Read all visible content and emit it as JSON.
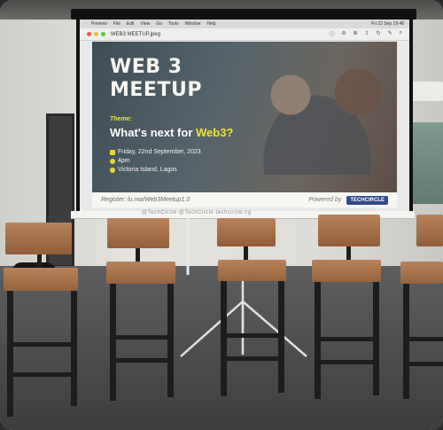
{
  "slide": {
    "menu_items": [
      "Preview",
      "File",
      "Edit",
      "View",
      "Go",
      "Tools",
      "Window",
      "Help"
    ],
    "clock": "Fri 22 Sep 19:48",
    "file_name": "WEB3 MEETUP.jpeg",
    "title_line1": "WEB 3",
    "title_line2": "MEETUP",
    "theme_label": "Theme:",
    "theme_text_prefix": "What's next for ",
    "theme_text_highlight": "Web3?",
    "date": "Friday, 22nd September, 2023",
    "time": "4pm",
    "location": "Victoria Island, Lagos",
    "register": "Register: lu.ma/Web3Meetup1.0",
    "powered_by": "Powered by",
    "brand": "TECHCIRCLE",
    "accent_color": "#f0e431",
    "brand_color": "#2f4a8e"
  },
  "ledge": {
    "watermark": "@TechCircle  @TechCircle  techcircle.ng"
  }
}
